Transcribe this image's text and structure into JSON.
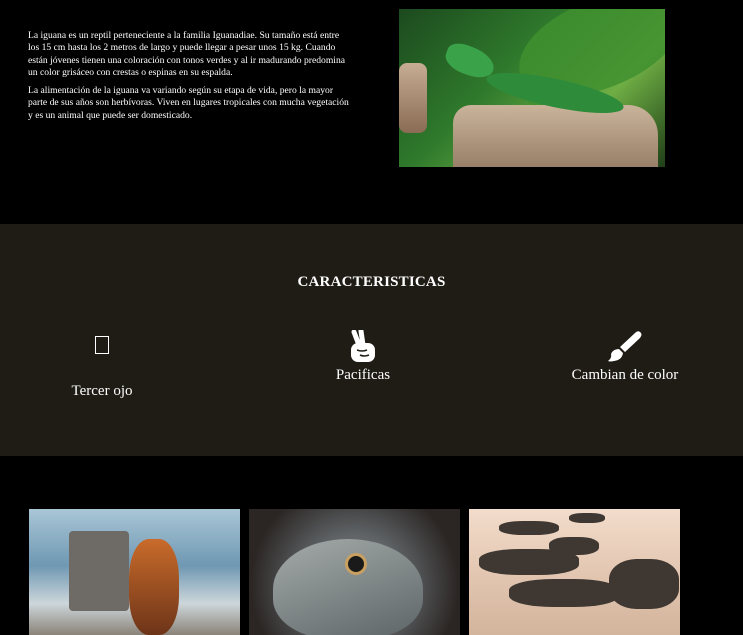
{
  "intro": {
    "paragraph1": "La iguana es un reptil perteneciente a la familia Iguanadiae. Su tamaño está entre los 15 cm hasta los 2 metros de largo y puede llegar a pesar unos 15 kg. Cuando están jóvenes tienen una coloración con tonos verdes y al ir madurando predomina un color grisáceo con crestas o espinas en su espalda.",
    "paragraph2": "La alimentación de la iguana va variando según su etapa de vida, pero la mayor parte de sus años son herbívoras. Viven en lugares tropicales con mucha vegetación y es un animal que puede ser domesticado."
  },
  "features": {
    "title": "CARACTERISTICAS",
    "items": [
      {
        "label": "Tercer ojo",
        "icon": "missing-glyph-icon"
      },
      {
        "label": "Pacificas",
        "icon": "peace-hand-icon"
      },
      {
        "label": "Cambian de color",
        "icon": "paint-brush-icon"
      }
    ]
  },
  "colors": {
    "page_background": "#000000",
    "features_background": "#1f1c16",
    "text": "#ffffff"
  }
}
